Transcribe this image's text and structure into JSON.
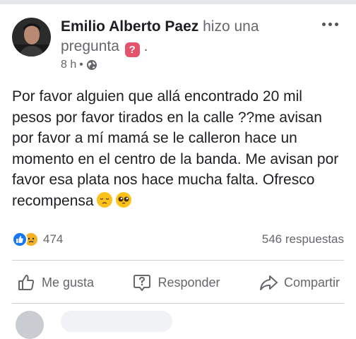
{
  "post": {
    "author_name": "Emilio Alberto Paez",
    "action_text": "hizo una pregunta",
    "action_suffix": ".",
    "time": "8 h",
    "separator": "•",
    "privacy_icon": "globe-icon",
    "body_text": "Por favor alguien que allá encontrado 20 mil pesos por favor tirados en la calle ??me avisan por favor a mí mamá se le calleron hace un momento en el centro de la banda. Me avisan por favor esa plata nos hace mucha falta. Ofresco recompensa",
    "body_emojis": [
      "pensive-face",
      "pleading-face"
    ]
  },
  "stats": {
    "reaction_icons": [
      "like",
      "sad"
    ],
    "reaction_count": "474",
    "answers_count": "546 respuestas"
  },
  "actions": {
    "like_label": "Me gusta",
    "answer_label": "Responder",
    "share_label": "Compartir"
  },
  "colors": {
    "link_blue": "#1877f2",
    "question_red": "#e4536b",
    "text_muted": "#65676b"
  }
}
